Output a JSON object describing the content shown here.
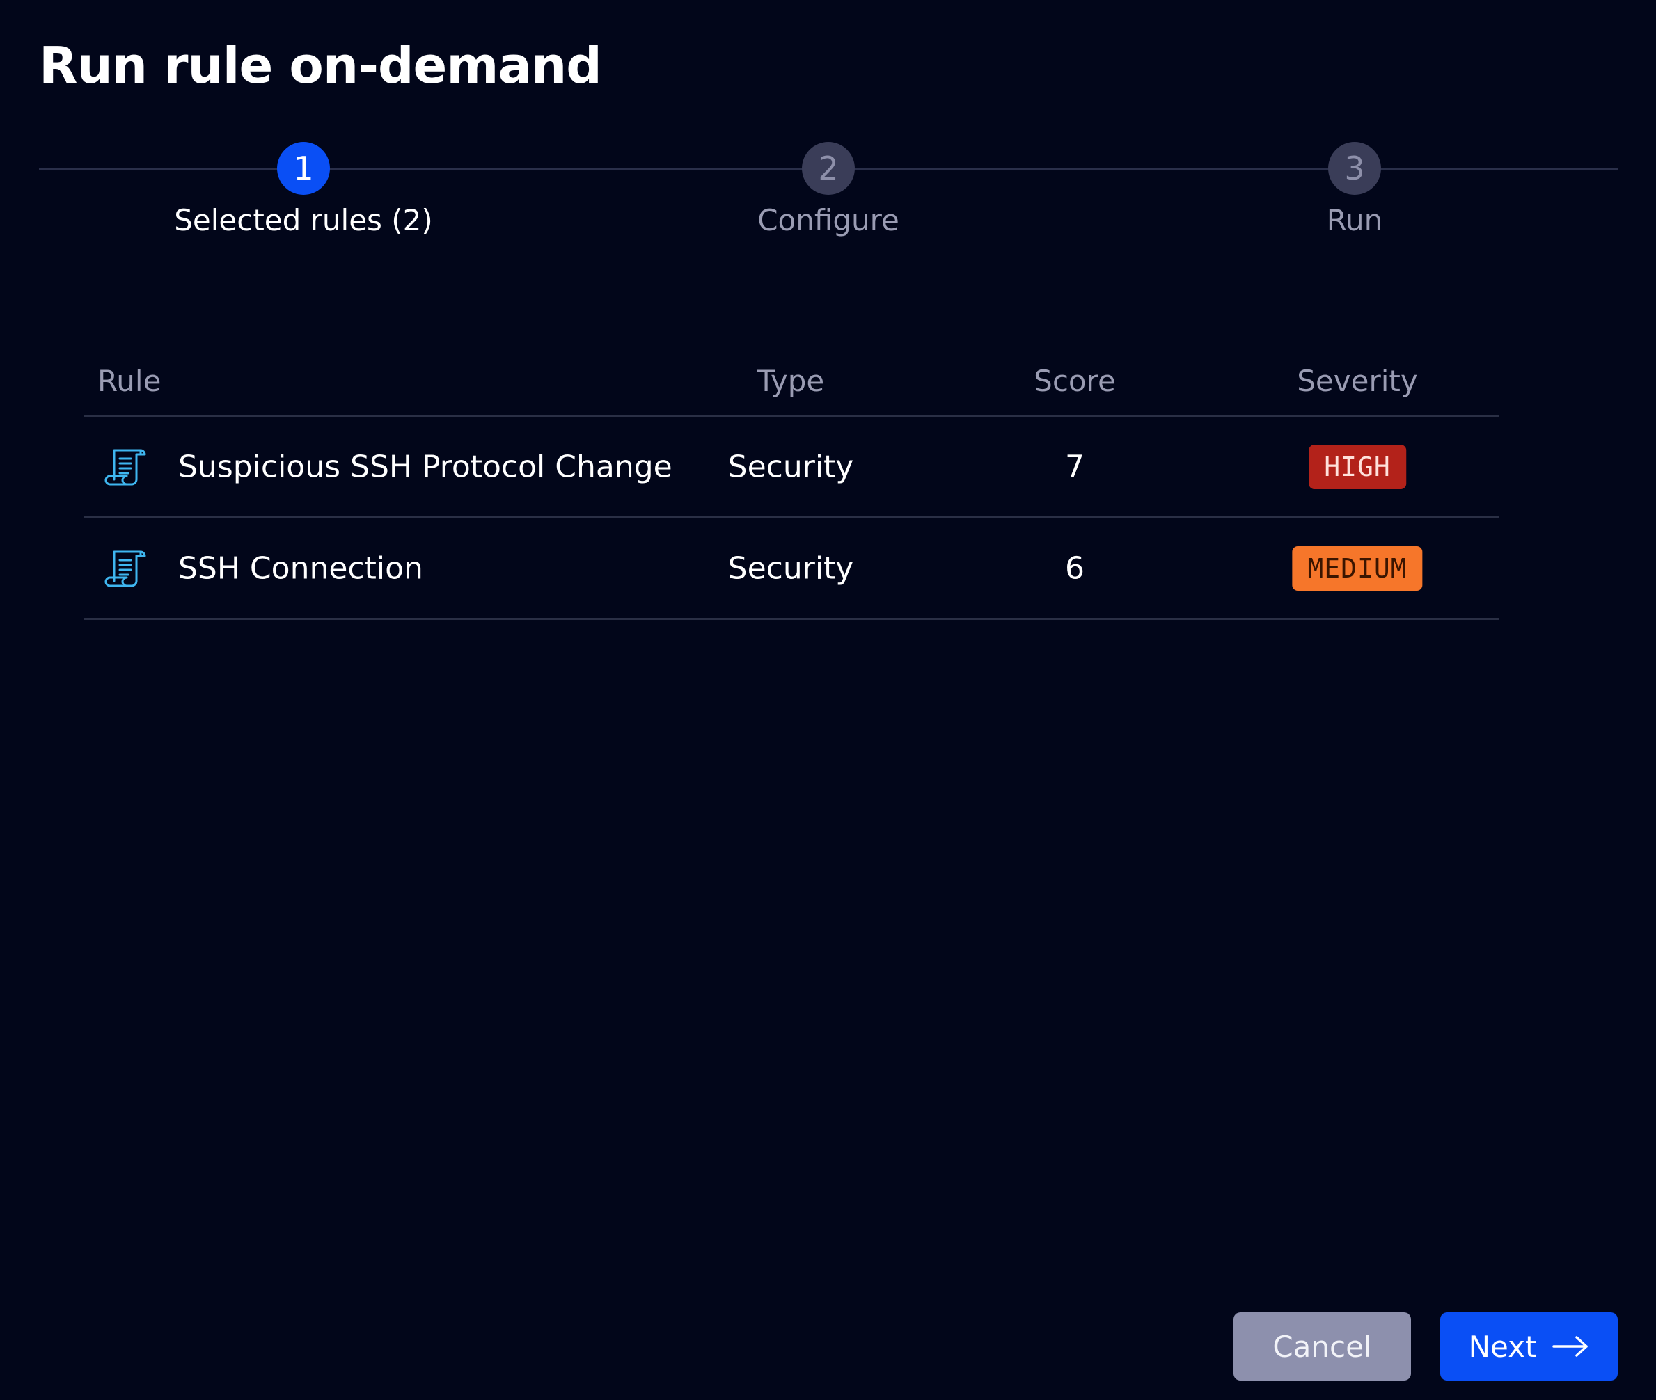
{
  "dialog": {
    "title": "Run rule on-demand"
  },
  "stepper": {
    "steps": [
      {
        "number": "1",
        "label": "Selected rules (2)",
        "state": "active"
      },
      {
        "number": "2",
        "label": "Configure",
        "state": "inactive"
      },
      {
        "number": "3",
        "label": "Run",
        "state": "inactive"
      }
    ]
  },
  "table": {
    "headers": {
      "rule": "Rule",
      "type": "Type",
      "score": "Score",
      "severity": "Severity"
    },
    "rows": [
      {
        "icon": "rule-scroll-icon",
        "rule": "Suspicious SSH Protocol Change",
        "type": "Security",
        "score": "7",
        "severity": "HIGH"
      },
      {
        "icon": "rule-scroll-icon",
        "rule": "SSH Connection",
        "type": "Security",
        "score": "6",
        "severity": "MEDIUM"
      }
    ]
  },
  "footer": {
    "cancel_label": "Cancel",
    "next_label": "Next",
    "next_icon": "arrow-right-icon"
  },
  "colors": {
    "background": "#02061a",
    "primary": "#0a4ff5",
    "severity_high": "#b3221a",
    "severity_medium": "#f6762a",
    "icon_accent": "#3fb6f0"
  }
}
